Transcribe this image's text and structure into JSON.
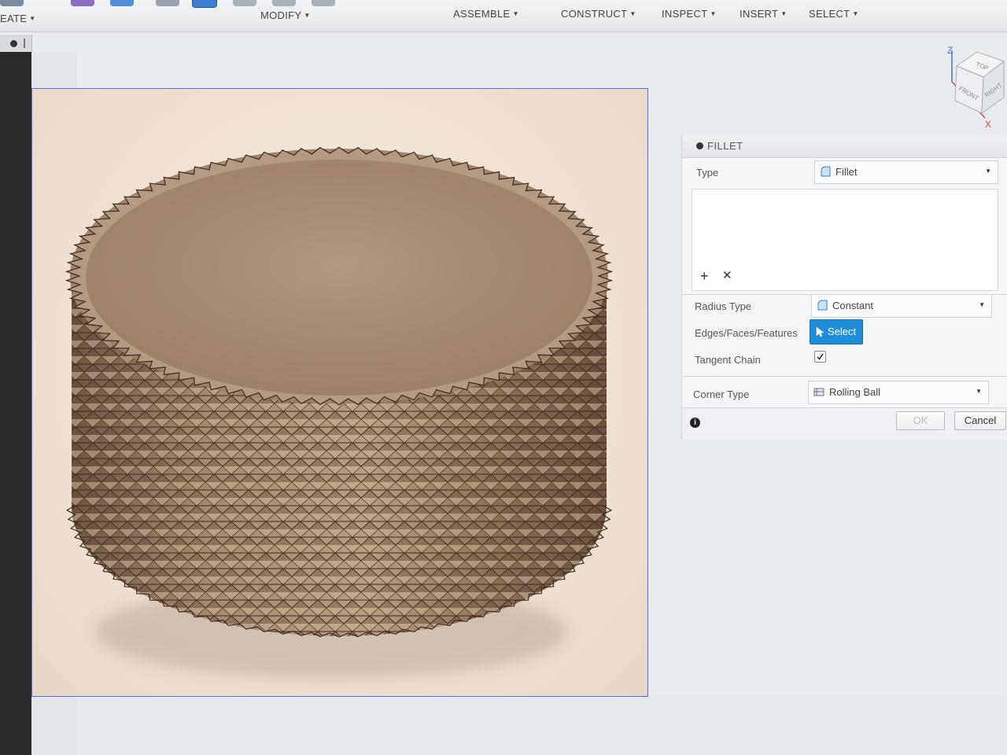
{
  "toolbar": {
    "menus": [
      {
        "label": "EATE"
      },
      {
        "label": "MODIFY"
      },
      {
        "label": "ASSEMBLE"
      },
      {
        "label": "CONSTRUCT"
      },
      {
        "label": "INSPECT"
      },
      {
        "label": "INSERT"
      },
      {
        "label": "SELECT"
      }
    ]
  },
  "viewcube": {
    "axis_z": "Z",
    "axis_x": "X",
    "face_top": "TOP",
    "face_front": "FRONT",
    "face_right": "RIGHT"
  },
  "fillet_panel": {
    "title": "FILLET",
    "type_label": "Type",
    "type_value": "Fillet",
    "radius_type_label": "Radius Type",
    "radius_type_value": "Constant",
    "edges_label": "Edges/Faces/Features",
    "select_button": "Select",
    "tangent_chain_label": "Tangent Chain",
    "tangent_chain_checked": true,
    "corner_type_label": "Corner Type",
    "corner_type_value": "Rolling Ball",
    "ok_label": "OK",
    "cancel_label": "Cancel"
  },
  "colors": {
    "accent": "#1f8ed6",
    "viewport_border": "#5c6ce0",
    "knurl_face": "#a58567",
    "knurl_edge": "#3b2a1c"
  }
}
